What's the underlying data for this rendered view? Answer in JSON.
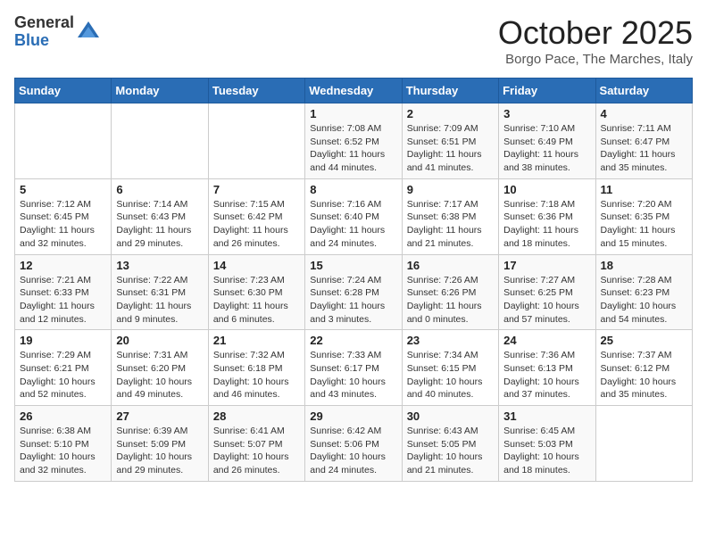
{
  "header": {
    "logo_general": "General",
    "logo_blue": "Blue",
    "title": "October 2025",
    "location": "Borgo Pace, The Marches, Italy"
  },
  "weekdays": [
    "Sunday",
    "Monday",
    "Tuesday",
    "Wednesday",
    "Thursday",
    "Friday",
    "Saturday"
  ],
  "weeks": [
    [
      {
        "day": "",
        "info": ""
      },
      {
        "day": "",
        "info": ""
      },
      {
        "day": "",
        "info": ""
      },
      {
        "day": "1",
        "info": "Sunrise: 7:08 AM\nSunset: 6:52 PM\nDaylight: 11 hours\nand 44 minutes."
      },
      {
        "day": "2",
        "info": "Sunrise: 7:09 AM\nSunset: 6:51 PM\nDaylight: 11 hours\nand 41 minutes."
      },
      {
        "day": "3",
        "info": "Sunrise: 7:10 AM\nSunset: 6:49 PM\nDaylight: 11 hours\nand 38 minutes."
      },
      {
        "day": "4",
        "info": "Sunrise: 7:11 AM\nSunset: 6:47 PM\nDaylight: 11 hours\nand 35 minutes."
      }
    ],
    [
      {
        "day": "5",
        "info": "Sunrise: 7:12 AM\nSunset: 6:45 PM\nDaylight: 11 hours\nand 32 minutes."
      },
      {
        "day": "6",
        "info": "Sunrise: 7:14 AM\nSunset: 6:43 PM\nDaylight: 11 hours\nand 29 minutes."
      },
      {
        "day": "7",
        "info": "Sunrise: 7:15 AM\nSunset: 6:42 PM\nDaylight: 11 hours\nand 26 minutes."
      },
      {
        "day": "8",
        "info": "Sunrise: 7:16 AM\nSunset: 6:40 PM\nDaylight: 11 hours\nand 24 minutes."
      },
      {
        "day": "9",
        "info": "Sunrise: 7:17 AM\nSunset: 6:38 PM\nDaylight: 11 hours\nand 21 minutes."
      },
      {
        "day": "10",
        "info": "Sunrise: 7:18 AM\nSunset: 6:36 PM\nDaylight: 11 hours\nand 18 minutes."
      },
      {
        "day": "11",
        "info": "Sunrise: 7:20 AM\nSunset: 6:35 PM\nDaylight: 11 hours\nand 15 minutes."
      }
    ],
    [
      {
        "day": "12",
        "info": "Sunrise: 7:21 AM\nSunset: 6:33 PM\nDaylight: 11 hours\nand 12 minutes."
      },
      {
        "day": "13",
        "info": "Sunrise: 7:22 AM\nSunset: 6:31 PM\nDaylight: 11 hours\nand 9 minutes."
      },
      {
        "day": "14",
        "info": "Sunrise: 7:23 AM\nSunset: 6:30 PM\nDaylight: 11 hours\nand 6 minutes."
      },
      {
        "day": "15",
        "info": "Sunrise: 7:24 AM\nSunset: 6:28 PM\nDaylight: 11 hours\nand 3 minutes."
      },
      {
        "day": "16",
        "info": "Sunrise: 7:26 AM\nSunset: 6:26 PM\nDaylight: 11 hours\nand 0 minutes."
      },
      {
        "day": "17",
        "info": "Sunrise: 7:27 AM\nSunset: 6:25 PM\nDaylight: 10 hours\nand 57 minutes."
      },
      {
        "day": "18",
        "info": "Sunrise: 7:28 AM\nSunset: 6:23 PM\nDaylight: 10 hours\nand 54 minutes."
      }
    ],
    [
      {
        "day": "19",
        "info": "Sunrise: 7:29 AM\nSunset: 6:21 PM\nDaylight: 10 hours\nand 52 minutes."
      },
      {
        "day": "20",
        "info": "Sunrise: 7:31 AM\nSunset: 6:20 PM\nDaylight: 10 hours\nand 49 minutes."
      },
      {
        "day": "21",
        "info": "Sunrise: 7:32 AM\nSunset: 6:18 PM\nDaylight: 10 hours\nand 46 minutes."
      },
      {
        "day": "22",
        "info": "Sunrise: 7:33 AM\nSunset: 6:17 PM\nDaylight: 10 hours\nand 43 minutes."
      },
      {
        "day": "23",
        "info": "Sunrise: 7:34 AM\nSunset: 6:15 PM\nDaylight: 10 hours\nand 40 minutes."
      },
      {
        "day": "24",
        "info": "Sunrise: 7:36 AM\nSunset: 6:13 PM\nDaylight: 10 hours\nand 37 minutes."
      },
      {
        "day": "25",
        "info": "Sunrise: 7:37 AM\nSunset: 6:12 PM\nDaylight: 10 hours\nand 35 minutes."
      }
    ],
    [
      {
        "day": "26",
        "info": "Sunrise: 6:38 AM\nSunset: 5:10 PM\nDaylight: 10 hours\nand 32 minutes."
      },
      {
        "day": "27",
        "info": "Sunrise: 6:39 AM\nSunset: 5:09 PM\nDaylight: 10 hours\nand 29 minutes."
      },
      {
        "day": "28",
        "info": "Sunrise: 6:41 AM\nSunset: 5:07 PM\nDaylight: 10 hours\nand 26 minutes."
      },
      {
        "day": "29",
        "info": "Sunrise: 6:42 AM\nSunset: 5:06 PM\nDaylight: 10 hours\nand 24 minutes."
      },
      {
        "day": "30",
        "info": "Sunrise: 6:43 AM\nSunset: 5:05 PM\nDaylight: 10 hours\nand 21 minutes."
      },
      {
        "day": "31",
        "info": "Sunrise: 6:45 AM\nSunset: 5:03 PM\nDaylight: 10 hours\nand 18 minutes."
      },
      {
        "day": "",
        "info": ""
      }
    ]
  ]
}
